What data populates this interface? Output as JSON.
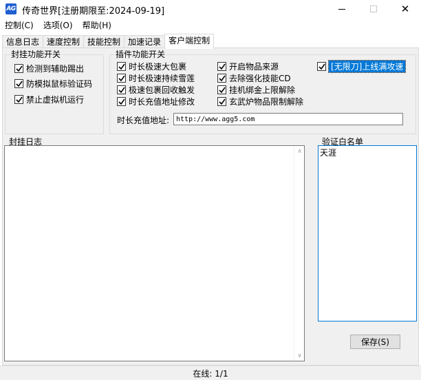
{
  "window": {
    "title": "传奇世界[注册期限至:2024-09-19]",
    "icon": "app-logo-icon",
    "icon_text": "AG"
  },
  "menu": [
    {
      "label": "控制(C)"
    },
    {
      "label": "选项(O)"
    },
    {
      "label": "帮助(H)"
    }
  ],
  "tabs": [
    {
      "label": "信息日志",
      "active": false
    },
    {
      "label": "速度控制",
      "active": false
    },
    {
      "label": "技能控制",
      "active": false
    },
    {
      "label": "加速记录",
      "active": false
    },
    {
      "label": "客户端控制",
      "active": true
    }
  ],
  "block_switch": {
    "title": "封挂功能开关",
    "items": [
      {
        "label": "检测到辅助踢出",
        "checked": true
      },
      {
        "label": "防模拟鼠标验证码",
        "checked": true
      },
      {
        "label": "禁止虚拟机运行",
        "checked": true
      }
    ]
  },
  "plugin_switch": {
    "title": "插件功能开关",
    "items": [
      {
        "label": "时长极速大包裹",
        "checked": true
      },
      {
        "label": "时长极速持续雪莲",
        "checked": true
      },
      {
        "label": "极速包裹回收触发",
        "checked": true
      },
      {
        "label": "时长充值地址修改",
        "checked": true
      },
      {
        "label": "开启物品来源",
        "checked": true
      },
      {
        "label": "去除强化技能CD",
        "checked": true
      },
      {
        "label": "挂机绑金上限解除",
        "checked": true
      },
      {
        "label": "玄武炉物品限制解除",
        "checked": true
      },
      {
        "label": "[无限刀]上线满攻速",
        "checked": true,
        "focused": true
      }
    ],
    "recharge_label": "时长充值地址:",
    "recharge_url": "http://www.agg5.com"
  },
  "log": {
    "label": "封挂日志"
  },
  "whitelist": {
    "label": "验证白名单",
    "entries": [
      "天涯"
    ]
  },
  "save_button": {
    "label": "保存(S)"
  },
  "status": {
    "online": "在线: 1/1"
  },
  "colors": {
    "accent": "#0078d7",
    "panel": "#f0f0f0"
  }
}
